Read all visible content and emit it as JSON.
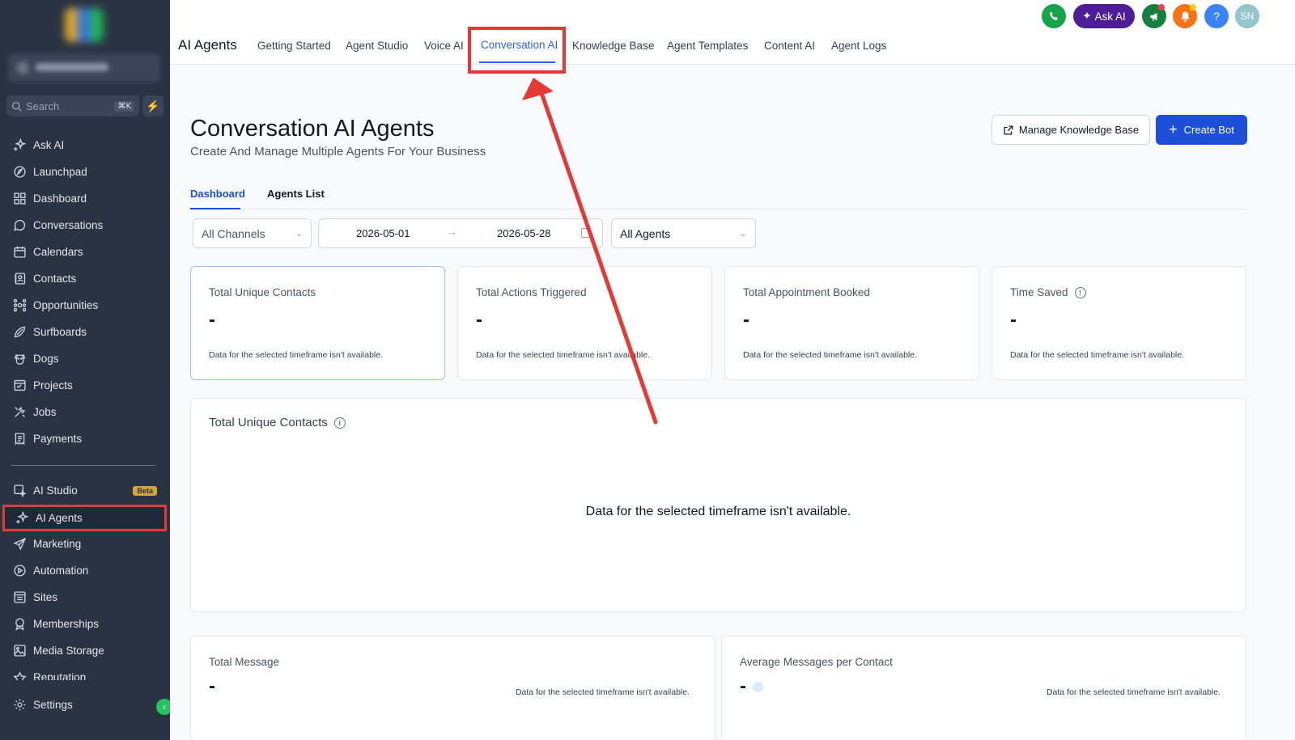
{
  "sidebar": {
    "search_placeholder": "Search",
    "search_shortcut": "⌘K",
    "items": [
      {
        "label": "Ask AI",
        "icon": "sparkle-icon"
      },
      {
        "label": "Launchpad",
        "icon": "rocket-icon"
      },
      {
        "label": "Dashboard",
        "icon": "grid-icon"
      },
      {
        "label": "Conversations",
        "icon": "chat-icon"
      },
      {
        "label": "Calendars",
        "icon": "calendar-icon"
      },
      {
        "label": "Contacts",
        "icon": "contacts-icon"
      },
      {
        "label": "Opportunities",
        "icon": "network-icon"
      },
      {
        "label": "Surfboards",
        "icon": "surfboard-icon"
      },
      {
        "label": "Dogs",
        "icon": "dog-icon"
      },
      {
        "label": "Projects",
        "icon": "projects-icon"
      },
      {
        "label": "Jobs",
        "icon": "tools-icon"
      },
      {
        "label": "Payments",
        "icon": "receipt-icon"
      },
      {
        "label": "AI Studio",
        "icon": "ai-studio-icon",
        "badge": "Beta"
      },
      {
        "label": "AI Agents",
        "icon": "sparkle-icon",
        "active": true
      },
      {
        "label": "Marketing",
        "icon": "send-icon"
      },
      {
        "label": "Automation",
        "icon": "play-circle-icon"
      },
      {
        "label": "Sites",
        "icon": "sites-icon"
      },
      {
        "label": "Memberships",
        "icon": "award-icon"
      },
      {
        "label": "Media Storage",
        "icon": "image-icon"
      },
      {
        "label": "Reputation",
        "icon": "star-icon"
      },
      {
        "label": "Settings",
        "icon": "gear-icon"
      }
    ]
  },
  "header": {
    "title": "AI Agents",
    "tabs": [
      {
        "label": "Getting Started"
      },
      {
        "label": "Agent Studio"
      },
      {
        "label": "Voice AI"
      },
      {
        "label": "Conversation AI",
        "active": true
      },
      {
        "label": "Knowledge Base"
      },
      {
        "label": "Agent Templates"
      },
      {
        "label": "Content AI"
      },
      {
        "label": "Agent Logs"
      }
    ],
    "ask_ai_label": "Ask AI",
    "help_label": "?",
    "avatar_initials": "SN",
    "colors": {
      "phone": "#16a34a",
      "ask_ai": "#4c1d95",
      "megaphone": "#15803d",
      "bell": "#f97316",
      "help": "#3b82f6",
      "avatar": "#93c5cc",
      "highlight": "#e53935"
    }
  },
  "page": {
    "title": "Conversation AI Agents",
    "subtitle": "Create And Manage Multiple Agents For Your Business",
    "manage_kb_label": "Manage Knowledge Base",
    "create_bot_label": "Create Bot",
    "subtabs": [
      {
        "label": "Dashboard",
        "active": true
      },
      {
        "label": "Agents List"
      }
    ],
    "filters": {
      "channel": "All Channels",
      "date_start": "2026-05-01",
      "date_end": "2026-05-28",
      "agent": "All Agents"
    },
    "stat_cards": [
      {
        "label": "Total Unique Contacts",
        "value": "-",
        "note": "Data for the selected timeframe isn't available."
      },
      {
        "label": "Total Actions Triggered",
        "value": "-",
        "note": "Data for the selected timeframe isn't available."
      },
      {
        "label": "Total Appointment Booked",
        "value": "-",
        "note": "Data for the selected timeframe isn't available."
      },
      {
        "label": "Time Saved",
        "value": "-",
        "note": "Data for the selected timeframe isn't available."
      }
    ],
    "contacts_chart": {
      "title": "Total Unique Contacts",
      "empty": "Data for the selected timeframe isn't available."
    },
    "bottom_cards": [
      {
        "label": "Total Message",
        "value": "-",
        "note": "Data for the selected timeframe isn't available."
      },
      {
        "label": "Average Messages per Contact",
        "value": "-",
        "note": "Data for the selected timeframe isn't available."
      }
    ]
  }
}
